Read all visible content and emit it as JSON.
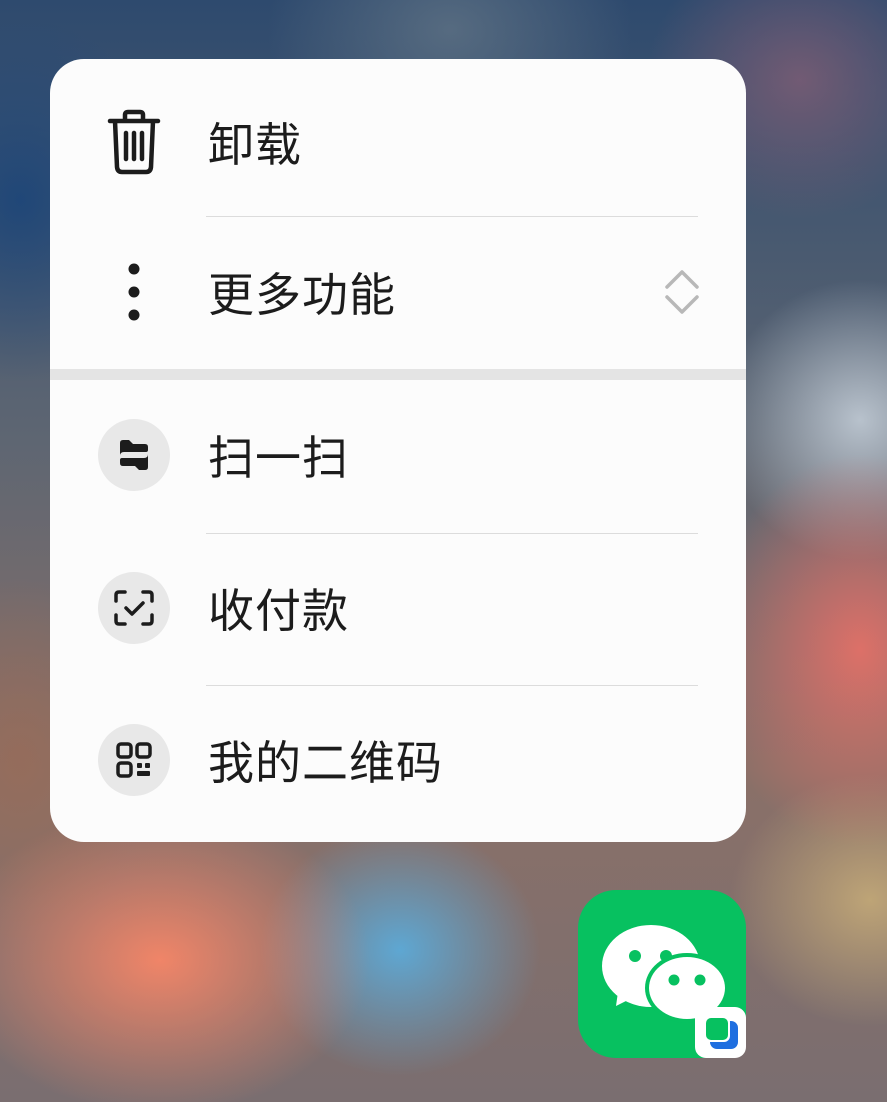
{
  "menu": {
    "section_top": [
      {
        "label": "卸载",
        "icon": "trash-icon"
      },
      {
        "label": "更多功能",
        "icon": "more-vertical-icon",
        "trailing_icon": "expand-updown-icon"
      }
    ],
    "section_bottom": [
      {
        "label": "扫一扫",
        "icon": "scan-icon"
      },
      {
        "label": "收付款",
        "icon": "pay-check-icon"
      },
      {
        "label": "我的二维码",
        "icon": "qrcode-icon"
      }
    ]
  },
  "app_icon": {
    "name": "wechat-app-icon",
    "badge": "clone-app-badge-icon",
    "colors": {
      "background": "#07c160",
      "bubble": "#ffffff",
      "badge_green": "#07c160",
      "badge_blue": "#1f6fe0"
    }
  },
  "colors": {
    "panel": "#fcfcfc",
    "text": "#1c1c1c",
    "icon_circle": "#e8e8e8",
    "divider": "#dcdcdc",
    "section_divider": "#e4e4e4"
  }
}
